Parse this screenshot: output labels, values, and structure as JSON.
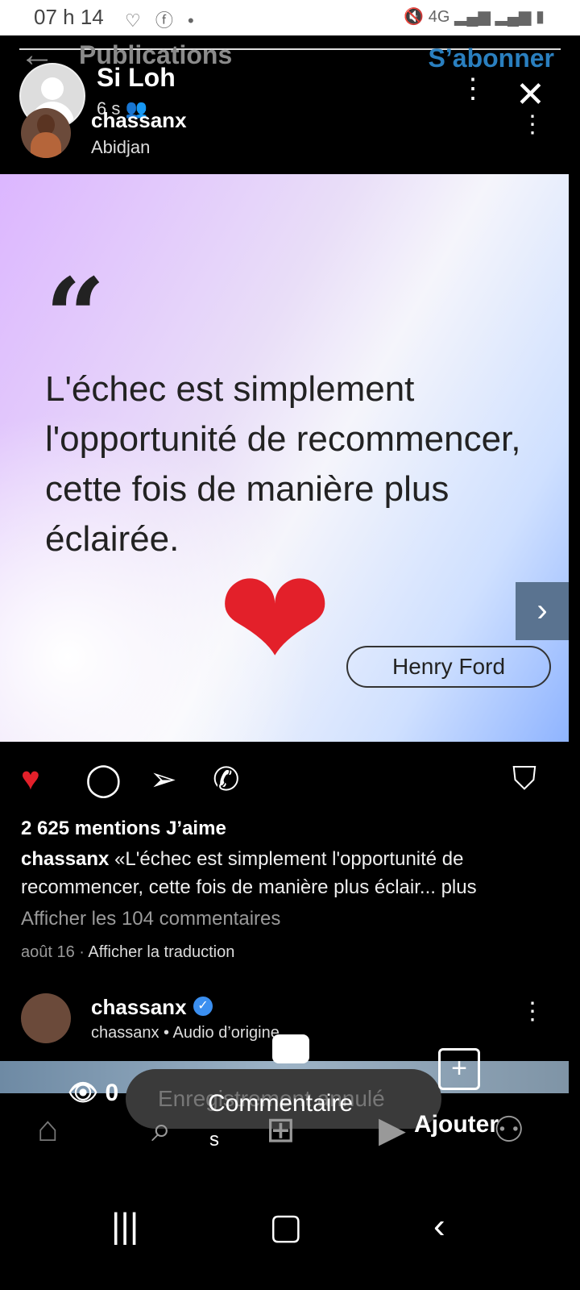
{
  "status": {
    "time": "07 h 14",
    "left_icons": "♡ ⓕ •",
    "right_icons": "🔇 4G ▂▄▆ ▂▄▆ ▮"
  },
  "header": {
    "title": "Publications",
    "subscribe": "S’abonner"
  },
  "overlay": {
    "name": "Si Loh",
    "time": "6 s"
  },
  "post": {
    "username": "chassanx",
    "location": "Abidjan",
    "quote": "L'échec est simplement l'opportunité de recommencer, cette fois de manière plus éclairée.",
    "author": "Henry Ford",
    "likes": "2 625 mentions J’aime",
    "caption_user": "chassanx",
    "caption_text": "«L'échec est simplement l'opportunité de recommencer, cette fois de manière plus éclair... plus",
    "comments": "Afficher les 104 commentaires",
    "date": "août 16",
    "translate": "Afficher la traduction"
  },
  "post2": {
    "username": "chassanx",
    "audio": "chassanx • Audio d’origine"
  },
  "bottom": {
    "views": "0",
    "toast": "Enregistrement annulé",
    "comment_label": "Commentaire",
    "comment_suffix": "s",
    "add_label": "Ajouter"
  },
  "colors": {
    "accent": "#2a7fbf",
    "like": "#e3202a",
    "verified": "#3b8ff0"
  }
}
